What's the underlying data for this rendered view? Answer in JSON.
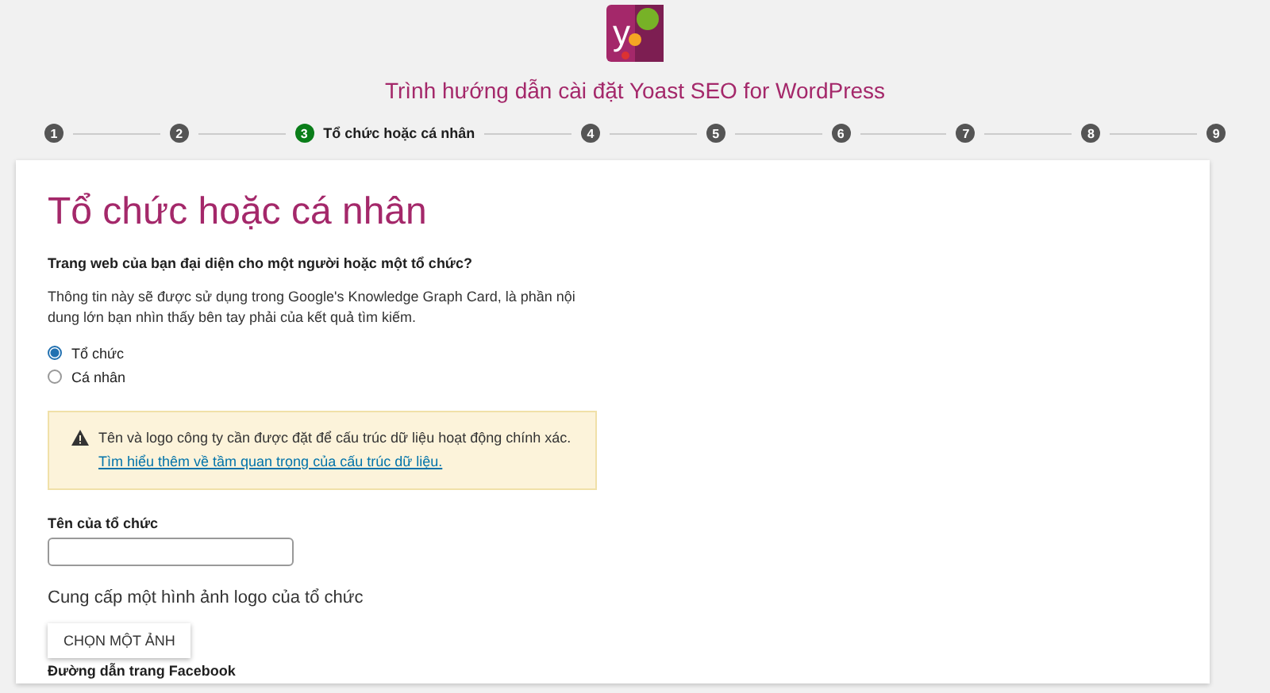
{
  "header": {
    "logo_letter": "y",
    "title": "Trình hướng dẫn cài đặt Yoast SEO for WordPress"
  },
  "steps": [
    {
      "number": "1",
      "selected": false
    },
    {
      "number": "2",
      "selected": false
    },
    {
      "number": "3",
      "label": "Tổ chức hoặc cá nhân",
      "selected": true
    },
    {
      "number": "4",
      "selected": false
    },
    {
      "number": "5",
      "selected": false
    },
    {
      "number": "6",
      "selected": false
    },
    {
      "number": "7",
      "selected": false
    },
    {
      "number": "8",
      "selected": false
    },
    {
      "number": "9",
      "selected": false
    }
  ],
  "card": {
    "heading": "Tổ chức hoặc cá nhân",
    "question": "Trang web của bạn đại diện cho một người hoặc một tổ chức?",
    "description": "Thông tin này sẽ được sử dụng trong Google's Knowledge Graph Card, là phần nội dung lớn bạn nhìn thấy bên tay phải của kết quả tìm kiếm.",
    "options": [
      {
        "label": "Tổ chức",
        "selected": true
      },
      {
        "label": "Cá nhân",
        "selected": false
      }
    ],
    "alert": {
      "text": "Tên và logo công ty cần được đặt để cấu trúc dữ liệu hoạt động chính xác.",
      "link": "Tìm hiểu thêm về tầm quan trọng của cấu trúc dữ liệu."
    },
    "name_label": "Tên của tổ chức",
    "logo_text": "Cung cấp một hình ảnh logo của tổ chức",
    "logo_button": "CHỌN MỘT ẢNH",
    "facebook_label": "Đường dẫn trang Facebook"
  }
}
